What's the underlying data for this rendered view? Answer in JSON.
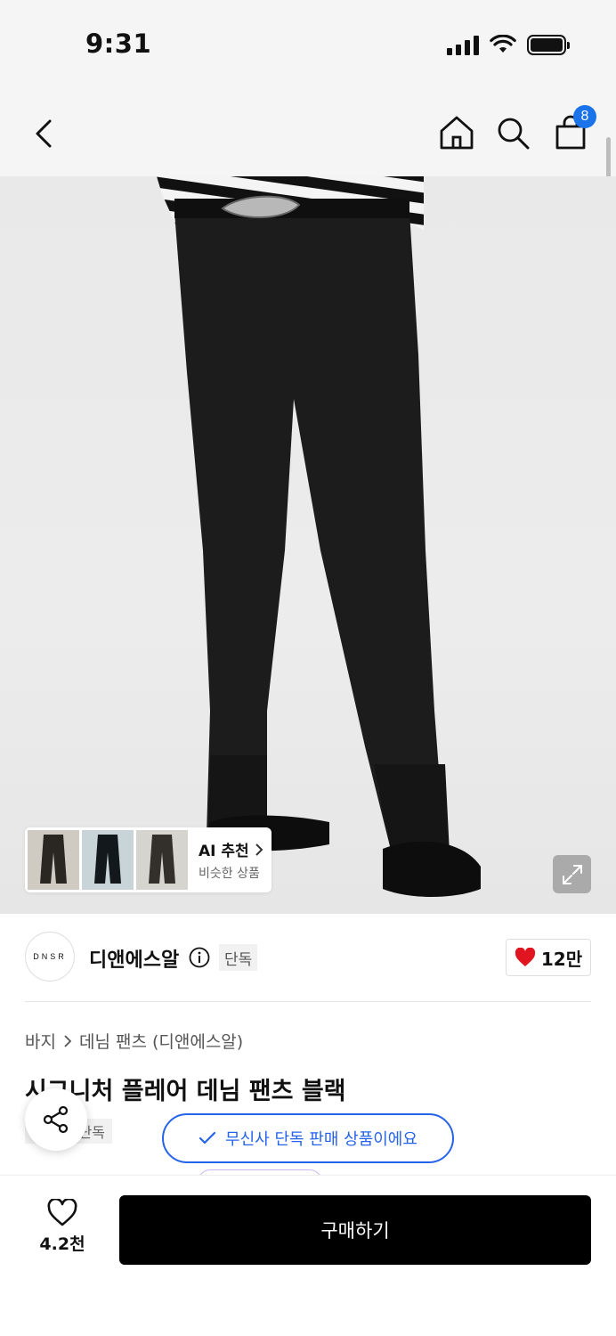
{
  "status_bar": {
    "time": "9:31"
  },
  "nav": {
    "cart_count": "8"
  },
  "ai_recommend": {
    "title": "AI 추천",
    "subtitle": "비슷한 상품"
  },
  "brand": {
    "logo_text": "DNSR",
    "name": "디앤에스알",
    "exclusive_label": "단독",
    "like_count": "12만"
  },
  "breadcrumb": {
    "category": "바지",
    "subcategory": "데님 팬츠 (디앤에스알)"
  },
  "product": {
    "title": "시그니처 플레어 데님 팬츠 블랙",
    "tag": "단독"
  },
  "toast": {
    "message": "무신사 단독 판매 상품이에요"
  },
  "bottom_bar": {
    "like_count": "4.2천",
    "buy_label": "구매하기"
  },
  "colors": {
    "accent_blue": "#2563eb",
    "badge_blue": "#1a73e8",
    "heart_red": "#e0151f",
    "buy_button": "#000000"
  }
}
